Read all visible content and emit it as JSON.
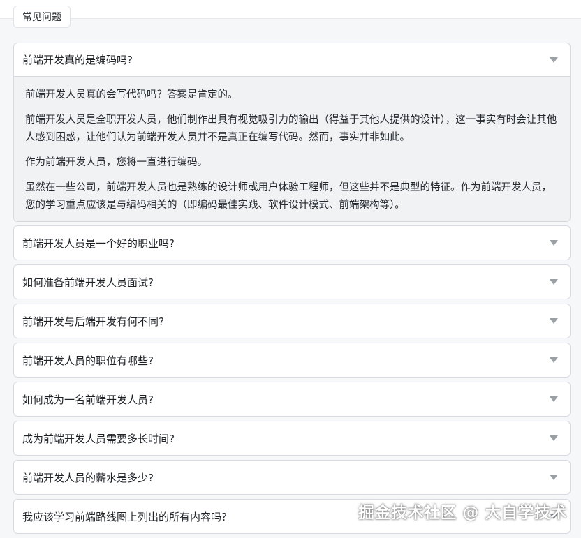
{
  "section_tab": {
    "label": "常见问题"
  },
  "faq": {
    "open_item": {
      "question": "前端开发真的是编码吗?",
      "answer": [
        "前端开发人员真的会写代码吗？答案是肯定的。",
        "前端开发人员是全职开发人员，他们制作出具有视觉吸引力的输出（得益于其他人提供的设计），这一事实有时会让其他人感到困惑，让他们认为前端开发人员并不是真正在编写代码。然而，事实并非如此。",
        "作为前端开发人员，您将一直进行编码。",
        "虽然在一些公司，前端开发人员也是熟练的设计师或用户体验工程师，但这些并不是典型的特征。作为前端开发人员，您的学习重点应该是与编码相关的（即编码最佳实践、软件设计模式、前端架构等）。"
      ]
    },
    "items": [
      {
        "question": "前端开发人员是一个好的职业吗?"
      },
      {
        "question": "如何准备前端开发人员面试?"
      },
      {
        "question": "前端开发与后端开发有何不同?"
      },
      {
        "question": "前端开发人员的职位有哪些?"
      },
      {
        "question": "如何成为一名前端开发人员?"
      },
      {
        "question": "成为前端开发人员需要多长时间?"
      },
      {
        "question": "前端开发人员的薪水是多少?"
      },
      {
        "question": "我应该学习前端路线图上列出的所有内容吗?"
      }
    ]
  },
  "watermark": {
    "text": "掘金技术社区 @ 大自学技术"
  },
  "colors": {
    "background": "#f6f7f9",
    "card": "#ffffff",
    "answer_bg": "#f1f2f4",
    "border": "#d6dae0",
    "caret": "#9aa0a6"
  },
  "icons": {
    "expand": "chevron-down-icon"
  }
}
